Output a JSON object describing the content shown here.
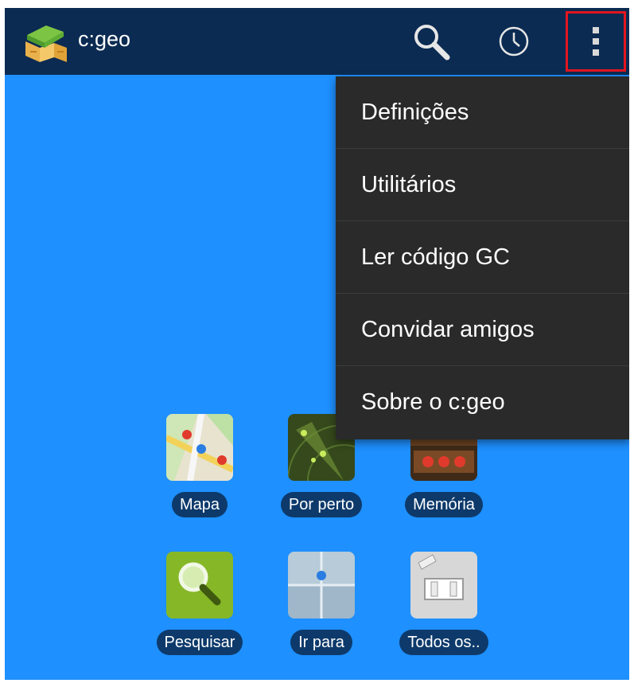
{
  "app": {
    "title": "c:geo"
  },
  "header": {
    "actions": [
      {
        "name": "search-icon"
      },
      {
        "name": "history-icon"
      },
      {
        "name": "more-vert-icon"
      }
    ]
  },
  "menu": {
    "items": [
      {
        "label": "Definições"
      },
      {
        "label": "Utilitários"
      },
      {
        "label": "Ler código GC"
      },
      {
        "label": "Convidar amigos"
      },
      {
        "label": "Sobre o c:geo"
      }
    ]
  },
  "tiles": [
    {
      "label": "Mapa",
      "icon": "map-icon"
    },
    {
      "label": "Por perto",
      "icon": "radar-icon"
    },
    {
      "label": "Memória",
      "icon": "stored-caches-icon"
    },
    {
      "label": "Pesquisar",
      "icon": "search-tile-icon"
    },
    {
      "label": "Ir para",
      "icon": "go-to-icon"
    },
    {
      "label": "Todos os..",
      "icon": "all-caches-icon"
    }
  ],
  "colors": {
    "background": "#1e90ff",
    "toolbar": "#0b2b52",
    "menu": "#2a2a2a",
    "label_pill": "#0d3a6b",
    "highlight": "#e4151f"
  }
}
